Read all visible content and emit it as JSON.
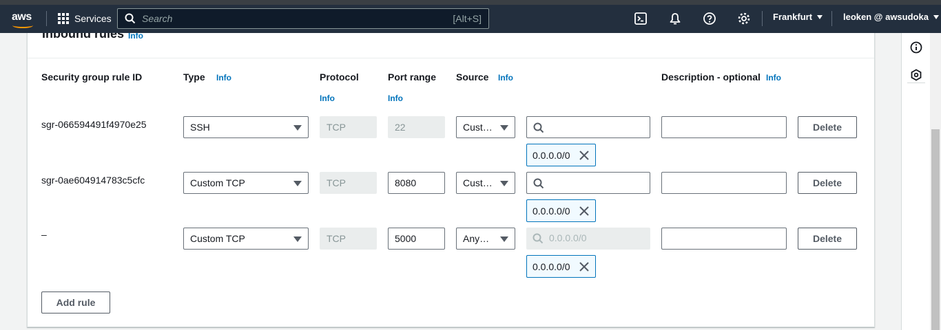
{
  "nav": {
    "logo_text": "aws",
    "services_label": "Services",
    "search_placeholder": "Search",
    "search_shortcut": "[Alt+S]",
    "region": "Frankfurt",
    "user": "leoken @ awsudoka"
  },
  "card": {
    "title": "Inbound rules",
    "title_info": "Info",
    "columns": {
      "rule_id": "Security group rule ID",
      "type": "Type",
      "type_info": "Info",
      "protocol": "Protocol",
      "protocol_info": "Info",
      "port_range": "Port range",
      "port_info": "Info",
      "source": "Source",
      "source_info": "Info",
      "description": "Description - optional",
      "description_info": "Info"
    },
    "rules": [
      {
        "id": "sgr-066594491f4970e25",
        "type": "SSH",
        "protocol": "TCP",
        "port": "22",
        "source": "Cust…",
        "cidr": "0.0.0.0/0",
        "search_placeholder": "",
        "delete": "Delete"
      },
      {
        "id": "sgr-0ae604914783c5cfc",
        "type": "Custom TCP",
        "protocol": "TCP",
        "port": "8080",
        "source": "Cust…",
        "cidr": "0.0.0.0/0",
        "search_placeholder": "",
        "delete": "Delete"
      },
      {
        "id": "–",
        "type": "Custom TCP",
        "protocol": "TCP",
        "port": "5000",
        "source": "Any…",
        "cidr": "0.0.0.0/0",
        "search_placeholder": "0.0.0.0/0",
        "delete": "Delete"
      }
    ],
    "add_rule": "Add rule"
  },
  "colors": {
    "nav_bg": "#232f3e",
    "accent": "#ff9900",
    "link": "#0073bb"
  }
}
